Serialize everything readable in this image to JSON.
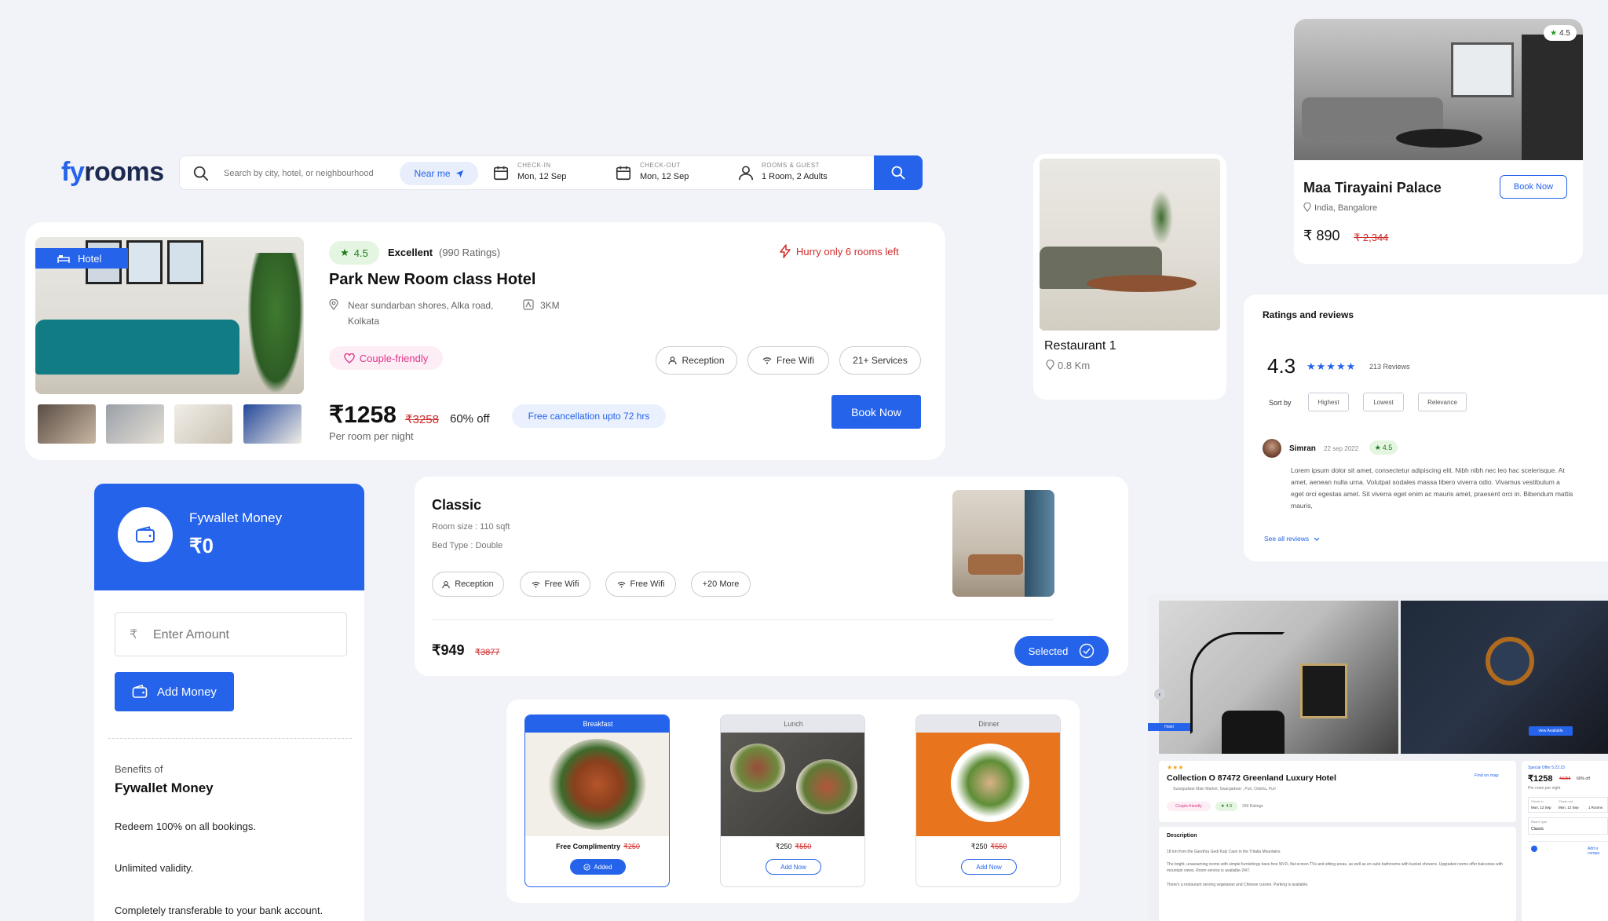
{
  "brand": {
    "part1": "fy",
    "part2": "rooms"
  },
  "search": {
    "placeholder": "Search by city, hotel, or neighbourhood",
    "near_me": "Near me",
    "checkin_label": "CHECK-IN",
    "checkin_value": "Mon, 12 Sep",
    "checkout_label": "CHECK-OUT",
    "checkout_value": "Mon, 12 Sep",
    "guests_label": "ROOMS & GUEST",
    "guests_value": "1 Room, 2 Adults"
  },
  "hotel_card": {
    "type_badge": "Hotel",
    "rating": "4.5",
    "rating_word": "Excellent",
    "rating_count": "(990 Ratings)",
    "urgency": "Hurry only 6 rooms left",
    "name": "Park New Room class Hotel",
    "address_line1": "Near sundarban shores, Alka road,",
    "address_line2": "Kolkata",
    "distance": "3KM",
    "tag": "Couple-friendly",
    "amenities": [
      "Reception",
      "Free Wifi",
      "21+ Services"
    ],
    "price": "₹1258",
    "old_price": "₹3258",
    "discount": "60% off",
    "per_night": "Per room per night",
    "cancellation": "Free cancellation upto 72 hrs",
    "book_now": "Book Now"
  },
  "palace_card": {
    "rating": "4.5",
    "name": "Maa Tirayaini Palace",
    "location": "India, Bangalore",
    "price": "₹ 890",
    "old_price": "₹ 2,344",
    "book_now": "Book Now"
  },
  "restaurant_card": {
    "name": "Restaurant 1",
    "distance": "0.8 Km"
  },
  "reviews": {
    "title": "Ratings and reviews",
    "score": "4.3",
    "count": "213 Reviews",
    "sort_label": "Sort by",
    "sort_options": [
      "Highest",
      "Lowest",
      "Relevance"
    ],
    "reviewer": "Simran",
    "date": "22 sep 2022",
    "reviewer_rating": "4.5",
    "text": "Lorem ipsum dolor sit amet, consectetur adipiscing elit. Nibh nibh nec leo hac scelerisque. At amet, aenean nulla urna. Volutpat sodales massa libero viverra odio. Vivamus vestibulum a eget orci egestas amet. Sit viverra eget enim ac mauris amet, praesent orci in. Bibendum mattis mauris,",
    "see_all": "See all reviews"
  },
  "wallet": {
    "title": "Fywallet Money",
    "balance": "₹0",
    "currency_symbol": "₹",
    "amount_placeholder": "Enter Amount",
    "add_money": "Add Money",
    "benefits_label": "Benefits of",
    "benefits_title": "Fywallet Money",
    "benefits": [
      "Redeem 100% on all bookings.",
      "Unlimited validity.",
      "Completely transferable to your bank account."
    ]
  },
  "room_card": {
    "name": "Classic",
    "size": "Room size : 110 sqft",
    "bed": "Bed Type : Double",
    "amenities": [
      "Reception",
      "Free Wifi",
      "Free Wifi",
      "+20 More"
    ],
    "price": "₹949",
    "old_price": "₹3877",
    "selected": "Selected"
  },
  "meals": [
    {
      "label": "Breakfast",
      "title": "Free Complimentry",
      "old_price": "₹250",
      "action": "Added",
      "active": true
    },
    {
      "label": "Lunch",
      "price": "₹250",
      "old_price": "₹550",
      "action": "Add Now",
      "active": false
    },
    {
      "label": "Dinner",
      "price": "₹250",
      "old_price": "₹550",
      "action": "Add Now",
      "active": false
    }
  ],
  "detail_preview": {
    "stars": "★★★",
    "name": "Collection O 87472 Greenland Luxury Hotel",
    "address": "Swargadwar Main Market, Swargadwar , Puri, Odisha, Puri",
    "find_on_map": "Find on map",
    "tag": "Couple-friendly",
    "rating": "4.5",
    "ratings_count": "339 Ratings",
    "description_title": "Description",
    "desc1": "18 km from the Gandhra Gedi Kaly Cave in the Tritalia Mountains",
    "desc2": "The bright, unassuming rooms with simple furnishings have free Wi-Fi, flat-screen TVs and sitting areas, as well as en suite bathrooms with bucket showers. Upgraded rooms offer balconies with mountain views. Room service is available 24/7.",
    "desc3": "There's a restaurant serving vegetarian and Chinese cuisine. Parking is available.",
    "special_offer": "Special Offer 5:22:23",
    "price": "₹1258",
    "old_price": "₹3258",
    "discount": "60% off",
    "per_night": "Per room per night",
    "checkin_label": "Check in",
    "checkin_value": "Mon, 12 Sep",
    "checkout_label": "Check out",
    "checkout_value": "Mon, 12 Sep",
    "rooms_value": "1 Rooms",
    "room_type_label": "Room Type",
    "room_type_value": "Classic",
    "add_compare": "Add a compa",
    "badge_left": "Hotel",
    "badge_right": "view Available"
  },
  "colors": {
    "primary": "#2563eb",
    "background": "#f2f3f8",
    "danger": "#d12b2b",
    "success": "#16a34a",
    "pink": "#e0338a"
  }
}
